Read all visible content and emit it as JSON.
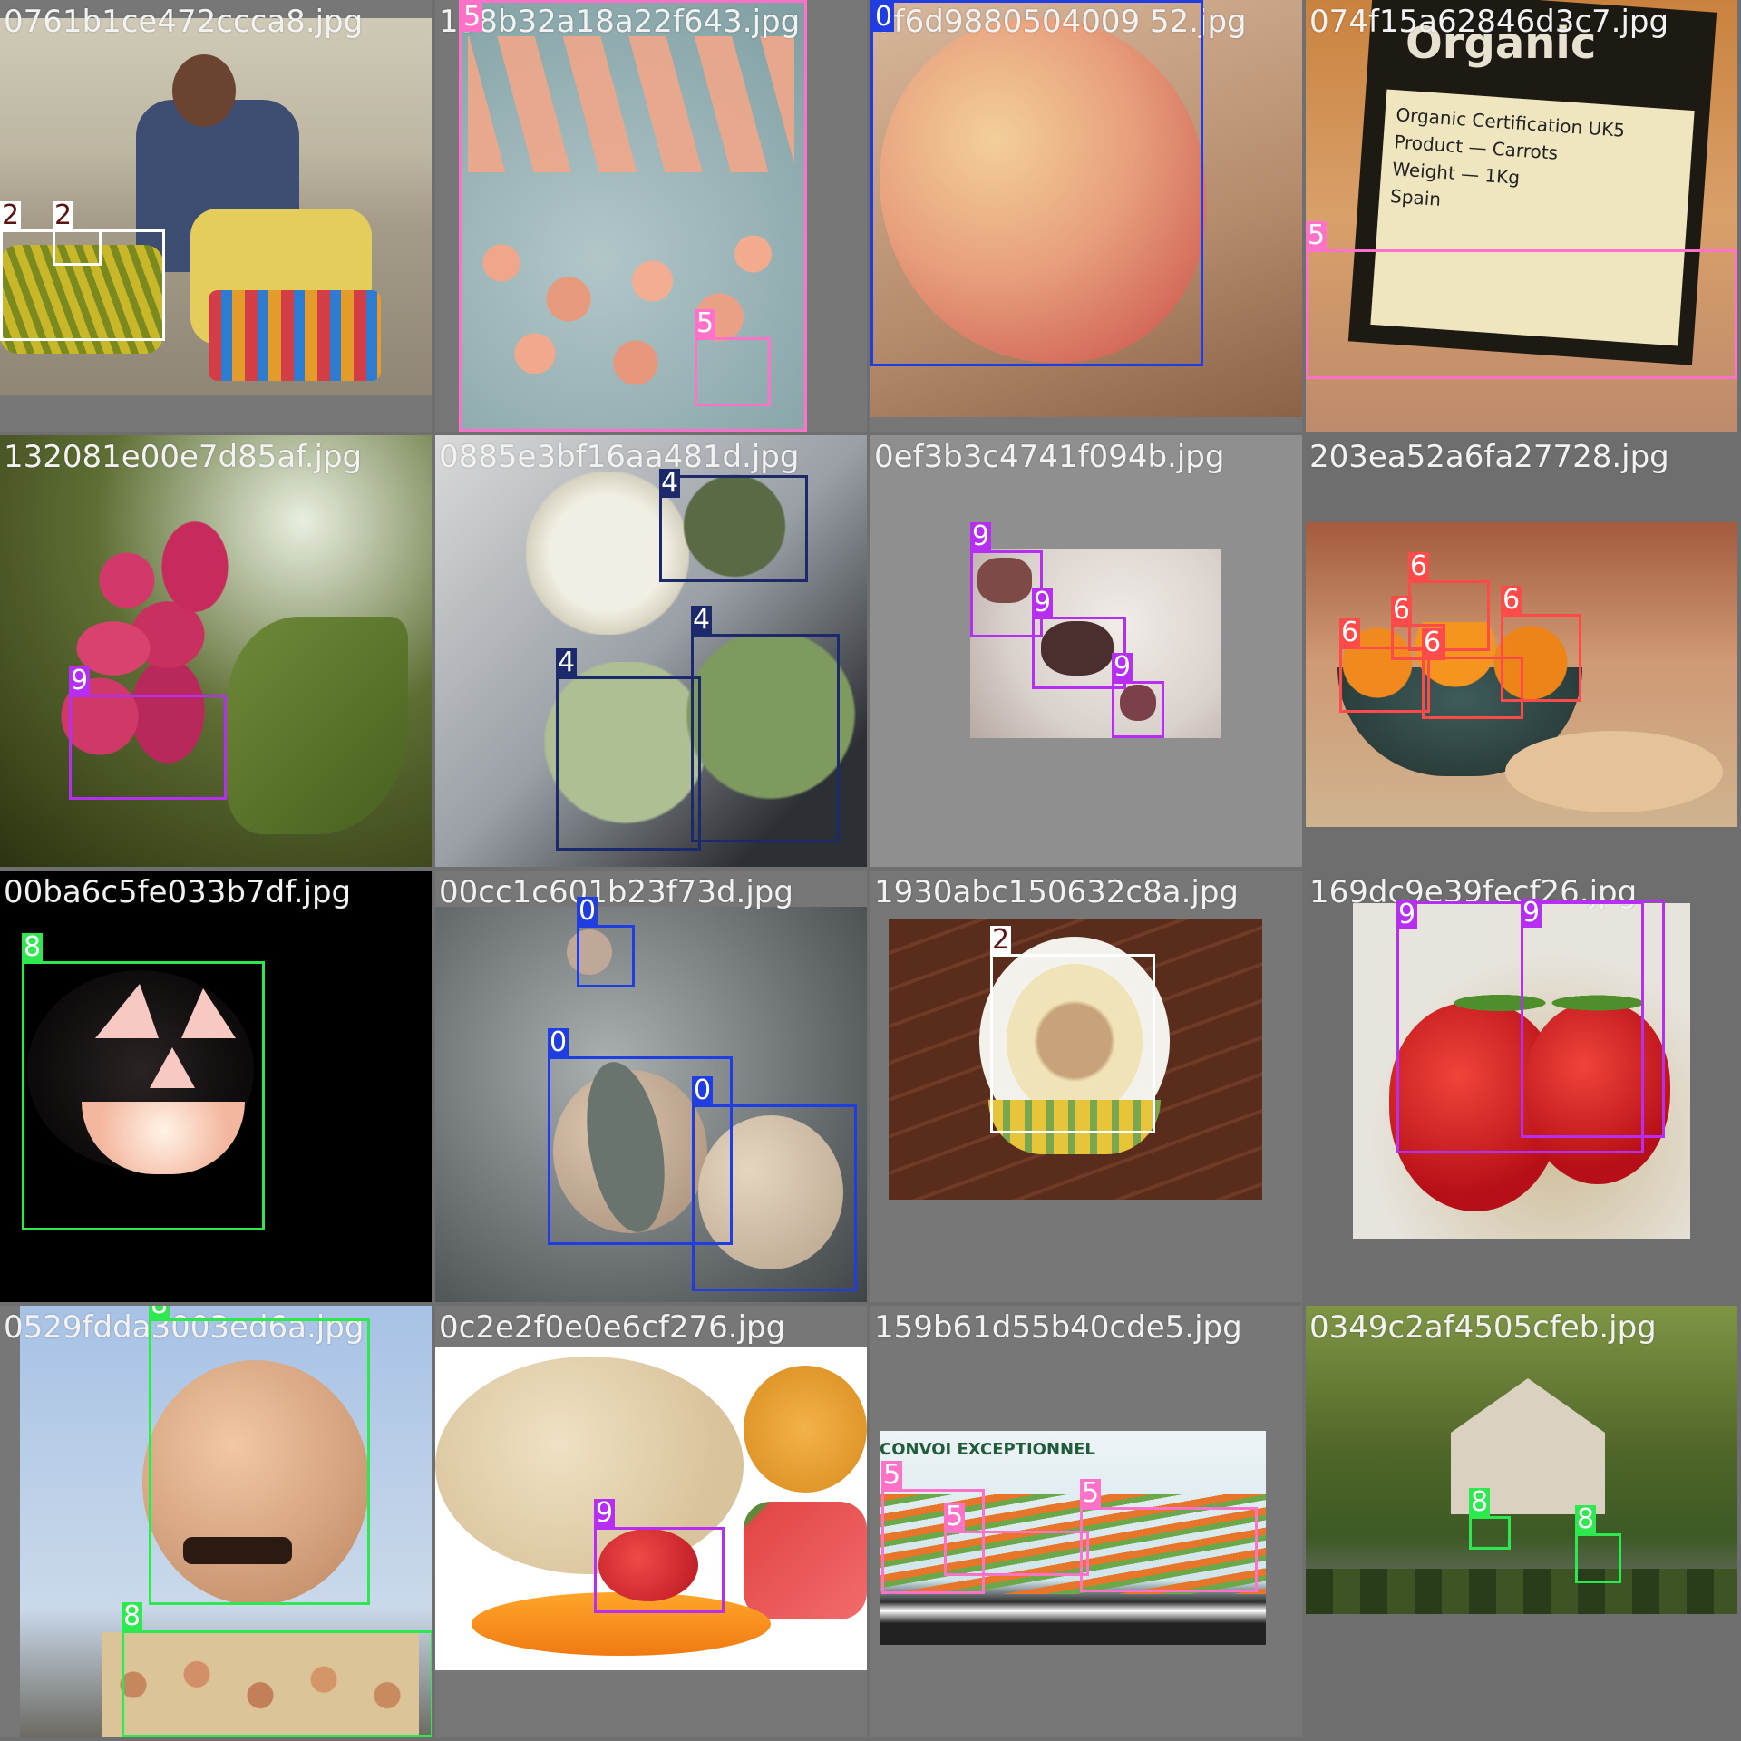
{
  "tiles": [
    {
      "filename": "0761b1ce472ccca8.jpg",
      "labels": [
        "2",
        "2"
      ]
    },
    {
      "filename": "158b32a18a22f643.jpg",
      "labels": [
        "5",
        "5"
      ]
    },
    {
      "filename": "0f6d9880504009 52.jpg",
      "labels": [
        "0"
      ]
    },
    {
      "filename": "074f15a62846d3c7.jpg",
      "labels": [
        "5"
      ]
    },
    {
      "filename": "132081e00e7d85af.jpg",
      "labels": [
        "9"
      ]
    },
    {
      "filename": "0885e3bf16aa481d.jpg",
      "labels": [
        "4",
        "4",
        "4"
      ]
    },
    {
      "filename": "0ef3b3c4741f094b.jpg",
      "labels": [
        "9",
        "9",
        "9"
      ]
    },
    {
      "filename": "203ea52a6fa27728.jpg",
      "labels": [
        "6",
        "6",
        "6",
        "6",
        "6"
      ]
    },
    {
      "filename": "00ba6c5fe033b7df.jpg",
      "labels": [
        "8"
      ]
    },
    {
      "filename": "00cc1c601b23f73d.jpg",
      "labels": [
        "0",
        "0",
        "0"
      ]
    },
    {
      "filename": "1930abc150632c8a.jpg",
      "labels": [
        "2"
      ]
    },
    {
      "filename": "169dc9e39fecf26.jpg",
      "labels": [
        "9",
        "9"
      ]
    },
    {
      "filename": "0529fdda3003ed6a.jpg",
      "labels": [
        "8",
        "8"
      ]
    },
    {
      "filename": "0c2e2f0e0e6cf276.jpg",
      "labels": [
        "9"
      ]
    },
    {
      "filename": "159b61d55b40cde5.jpg",
      "labels": [
        "5",
        "5",
        "5"
      ]
    },
    {
      "filename": "0349c2af4505cfeb.jpg",
      "labels": [
        "8",
        "8"
      ]
    }
  ],
  "truck_text": "CONVOI EXCEPTIONNEL",
  "bag_text": {
    "brand": "Organic",
    "line1": "Organic Certification UK5",
    "product": "Carrots",
    "product_key": "Product",
    "weight": "1Kg",
    "weight_key": "Weight",
    "origin": "Spain"
  },
  "class_colors": {
    "0": "#1f3de0",
    "2": "#ffffff",
    "4": "#1c2a6b",
    "5": "#ff72c8",
    "6": "#ff4a4a",
    "8": "#2ee850",
    "9": "#b52ef2"
  }
}
